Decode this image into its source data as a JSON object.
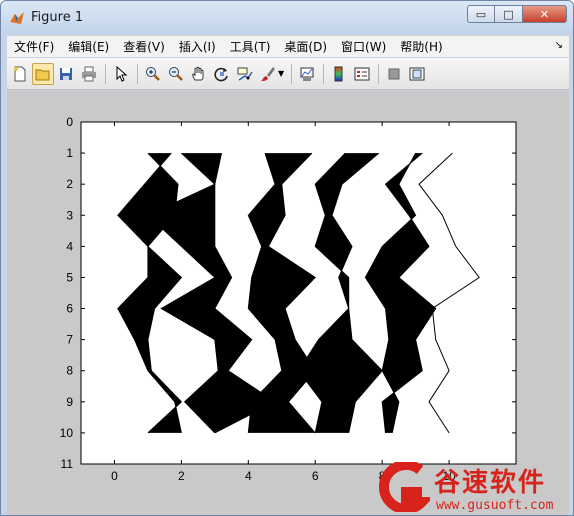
{
  "window": {
    "title": "Figure 1",
    "minimize": "▭",
    "maximize": "□",
    "close": "✕"
  },
  "menu": {
    "items": [
      {
        "label": "文件(F)"
      },
      {
        "label": "编辑(E)"
      },
      {
        "label": "查看(V)"
      },
      {
        "label": "插入(I)"
      },
      {
        "label": "工具(T)"
      },
      {
        "label": "桌面(D)"
      },
      {
        "label": "窗口(W)"
      },
      {
        "label": "帮助(H)"
      }
    ],
    "overflow": "↘"
  },
  "toolbar": {
    "icons": [
      "new-figure-icon",
      "open-file-icon",
      "save-icon",
      "print-icon",
      "pointer-icon",
      "zoom-in-icon",
      "zoom-out-icon",
      "pan-icon",
      "rotate-3d-icon",
      "data-cursor-icon",
      "brush-icon",
      "link-plot-icon",
      "colorbar-icon",
      "legend-icon",
      "hide-plot-tools-icon",
      "show-plot-tools-icon"
    ]
  },
  "chart_data": {
    "type": "other",
    "description": "",
    "xlim": [
      -1,
      12
    ],
    "ylim": [
      0,
      11
    ],
    "y_reversed": true,
    "xticks": [
      "0",
      "2",
      "4",
      "6",
      "8",
      "10"
    ],
    "xtick_values": [
      0,
      2,
      4,
      6,
      8,
      10
    ],
    "yticks": [
      "0",
      "1",
      "2",
      "3",
      "4",
      "5",
      "6",
      "7",
      "8",
      "9",
      "10",
      "11"
    ],
    "ytick_values": [
      0,
      1,
      2,
      3,
      4,
      5,
      6,
      7,
      8,
      9,
      10,
      11
    ],
    "title": "",
    "xlabel": "",
    "ylabel": "",
    "lines": [
      {
        "points": [
          [
            1,
            1
          ],
          [
            1.9,
            2
          ],
          [
            1.8,
            3
          ],
          [
            1,
            4
          ],
          [
            2,
            5
          ],
          [
            1.2,
            6
          ],
          [
            1,
            7
          ],
          [
            1.1,
            8
          ],
          [
            2,
            9
          ],
          [
            1,
            10
          ]
        ]
      },
      {
        "points": [
          [
            1.7,
            1
          ],
          [
            0.1,
            3
          ],
          [
            1,
            4
          ],
          [
            1,
            5
          ],
          [
            0.1,
            6
          ],
          [
            0.6,
            7
          ],
          [
            1,
            8
          ],
          [
            1.8,
            9
          ],
          [
            2,
            10
          ]
        ]
      },
      {
        "points": [
          [
            2,
            1
          ],
          [
            3,
            2
          ],
          [
            1,
            3
          ],
          [
            2,
            4
          ],
          [
            3,
            5
          ],
          [
            1.4,
            6
          ],
          [
            3,
            7
          ],
          [
            3.1,
            8
          ],
          [
            2.1,
            9
          ],
          [
            3,
            10
          ]
        ]
      },
      {
        "points": [
          [
            3.2,
            1
          ],
          [
            3,
            2
          ],
          [
            3,
            3
          ],
          [
            3,
            4
          ],
          [
            3.5,
            5
          ],
          [
            3,
            6
          ],
          [
            4.1,
            7
          ],
          [
            3.4,
            8
          ],
          [
            4.8,
            9
          ],
          [
            3,
            10
          ]
        ]
      },
      {
        "points": [
          [
            4.5,
            1
          ],
          [
            4.8,
            2
          ],
          [
            4,
            3
          ],
          [
            4.4,
            4
          ],
          [
            4.1,
            5
          ],
          [
            4,
            6
          ],
          [
            4.8,
            7
          ],
          [
            5,
            8
          ],
          [
            4.1,
            9
          ],
          [
            4,
            10
          ]
        ]
      },
      {
        "points": [
          [
            5.9,
            1
          ],
          [
            5,
            2
          ],
          [
            5.1,
            3
          ],
          [
            4.6,
            4
          ],
          [
            6,
            5
          ],
          [
            5.1,
            6
          ],
          [
            5.4,
            7
          ],
          [
            6,
            8
          ],
          [
            5.2,
            9
          ],
          [
            6,
            10
          ]
        ]
      },
      {
        "points": [
          [
            6.9,
            1
          ],
          [
            6,
            2
          ],
          [
            6.3,
            3
          ],
          [
            6,
            4
          ],
          [
            7,
            5
          ],
          [
            7,
            6
          ],
          [
            6.1,
            7
          ],
          [
            5.5,
            8
          ],
          [
            6.2,
            9
          ],
          [
            6,
            10
          ]
        ]
      },
      {
        "points": [
          [
            7.9,
            1
          ],
          [
            6.8,
            2
          ],
          [
            6.5,
            3
          ],
          [
            7.1,
            4
          ],
          [
            6.7,
            5
          ],
          [
            7,
            6
          ],
          [
            7.1,
            7
          ],
          [
            8,
            8
          ],
          [
            7.2,
            9
          ],
          [
            7,
            10
          ]
        ]
      },
      {
        "points": [
          [
            9,
            1
          ],
          [
            8.5,
            2
          ],
          [
            9,
            3
          ],
          [
            8,
            4
          ],
          [
            7.5,
            5
          ],
          [
            8.1,
            6
          ],
          [
            8.2,
            7
          ],
          [
            8,
            8
          ],
          [
            8.5,
            9
          ],
          [
            8.3,
            10
          ]
        ]
      },
      {
        "points": [
          [
            9.2,
            1
          ],
          [
            8.1,
            2
          ],
          [
            8.8,
            3
          ],
          [
            9.4,
            4
          ],
          [
            8.5,
            5
          ],
          [
            9.6,
            6
          ],
          [
            9,
            7
          ],
          [
            9.2,
            8
          ],
          [
            8,
            9
          ],
          [
            8.1,
            10
          ]
        ]
      },
      {
        "points": [
          [
            10.1,
            1
          ],
          [
            9.1,
            2
          ],
          [
            9.8,
            3
          ],
          [
            10.2,
            4
          ],
          [
            10.9,
            5
          ],
          [
            9.5,
            6
          ],
          [
            9.6,
            7
          ],
          [
            10,
            8
          ],
          [
            9.4,
            9
          ],
          [
            10,
            10
          ]
        ]
      }
    ]
  },
  "watermark": {
    "brand": "谷速软件",
    "domain": "www.gusuoft.com"
  }
}
